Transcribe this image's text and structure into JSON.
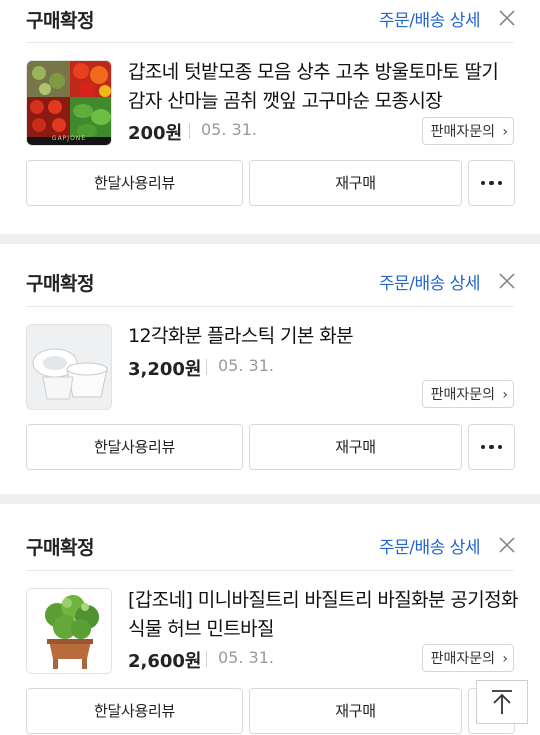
{
  "orders": [
    {
      "status": "구매확정",
      "detail_link": "주문/배송 상세",
      "product_name": "갑조네 텃밭모종 모음 상추 고추 방울토마토 딸기 감자 산마늘 곰취 깻잎 고구마순 모종시장",
      "price": "200원",
      "date": "05. 31.",
      "inquiry_label": "판매자문의",
      "review_label": "한달사용리뷰",
      "rebuy_label": "재구매",
      "thumb_logo": "GAPJONE"
    },
    {
      "status": "구매확정",
      "detail_link": "주문/배송 상세",
      "product_name": "12각화분 플라스틱 기본 화분",
      "price": "3,200원",
      "date": "05. 31.",
      "inquiry_label": "판매자문의",
      "review_label": "한달사용리뷰",
      "rebuy_label": "재구매"
    },
    {
      "status": "구매확정",
      "detail_link": "주문/배송 상세",
      "product_name": "[갑조네] 미니바질트리 바질트리 바질화분 공기정화식물 허브 민트바질",
      "price": "2,600원",
      "date": "05. 31.",
      "inquiry_label": "판매자문의",
      "review_label": "한달사용리뷰",
      "rebuy_label": "재구매"
    }
  ],
  "icons": {
    "close": "close-icon",
    "more": "more-dots-icon",
    "scroll_top": "arrow-up-to-top-icon",
    "chevron": "chevron-right-icon"
  }
}
